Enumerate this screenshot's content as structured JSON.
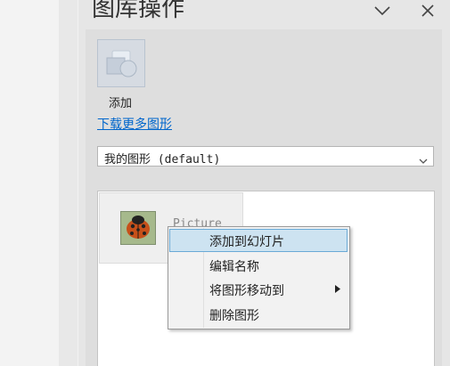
{
  "pane": {
    "title": "图库操作"
  },
  "library": {
    "add_label": "添加",
    "more_link": "下载更多图形",
    "category_value": "我的图形 (default)",
    "item_label": "Picture"
  },
  "context_menu": {
    "items": [
      "添加到幻灯片",
      "编辑名称",
      "将图形移动到",
      "删除图形"
    ]
  },
  "icons": {
    "dropdown": "chevron-down-icon",
    "close": "close-icon",
    "submenu": "triangle-right-icon",
    "shape": "shape-library-icon",
    "picture": "ladybug-picture"
  },
  "colors": {
    "link": "#0066cc",
    "menu_highlight": "#cde3f1",
    "menu_highlight_border": "#6aaad6"
  }
}
